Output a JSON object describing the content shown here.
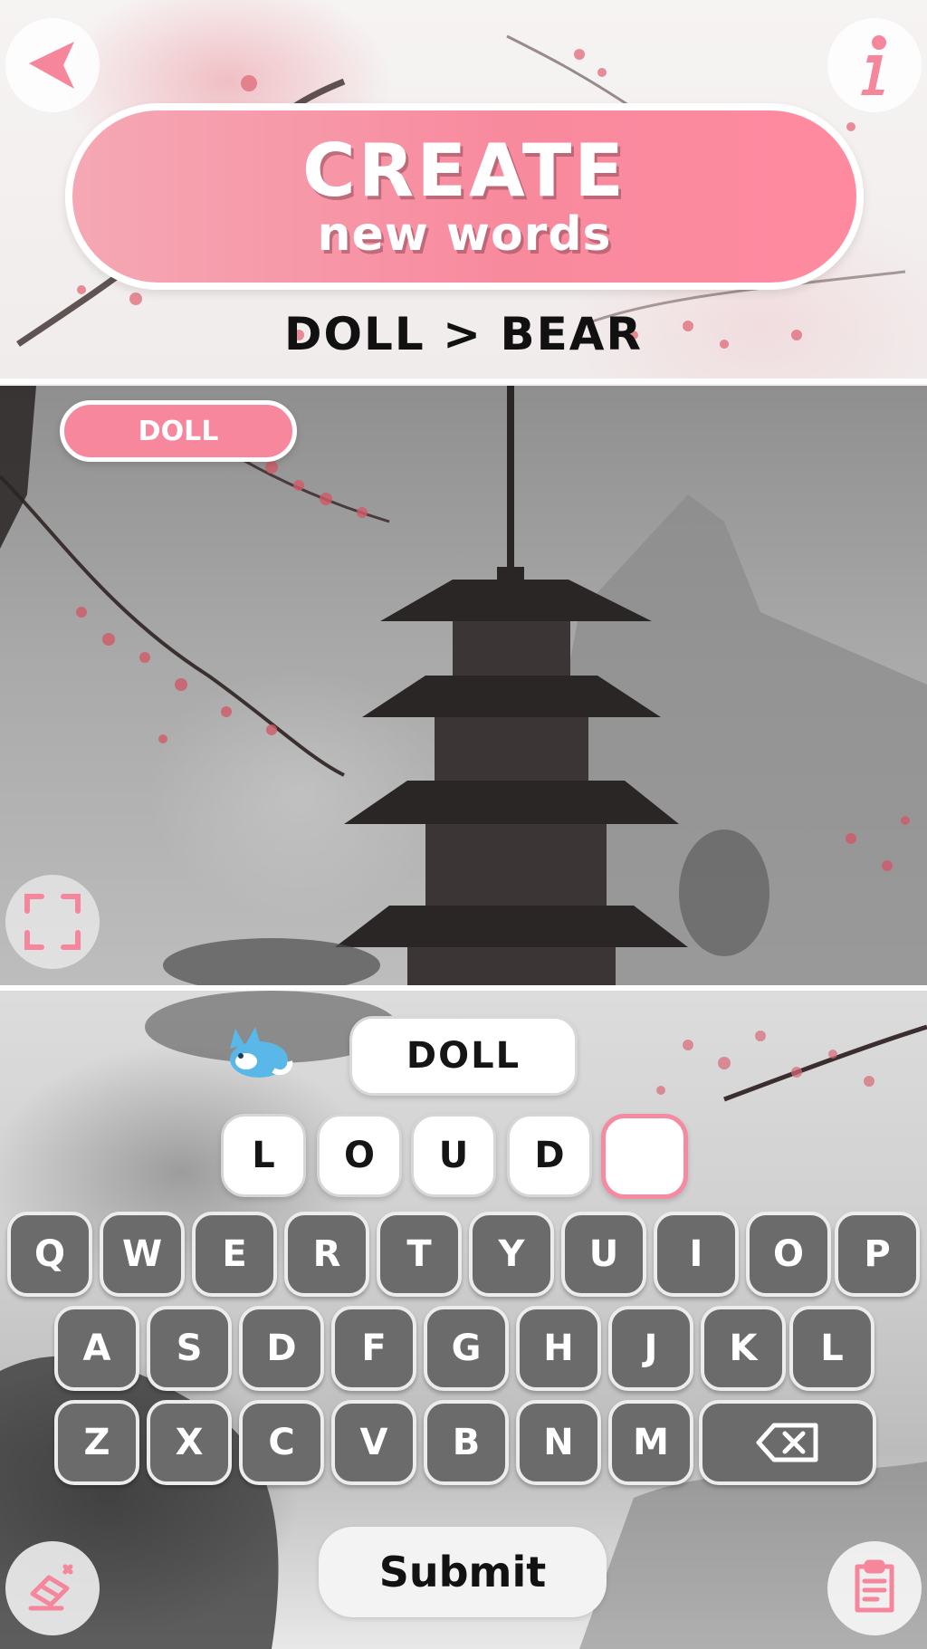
{
  "header": {
    "title_line1": "CREATE",
    "title_line2": "new words",
    "puzzle": "DOLL > BEAR"
  },
  "photo": {
    "word_tag": "DOLL"
  },
  "game": {
    "current_word": "DOLL",
    "tiles": [
      "L",
      "O",
      "U",
      "D",
      ""
    ]
  },
  "keyboard": {
    "row1": [
      "Q",
      "W",
      "E",
      "R",
      "T",
      "Y",
      "U",
      "I",
      "O",
      "P"
    ],
    "row2": [
      "A",
      "S",
      "D",
      "F",
      "G",
      "H",
      "J",
      "K",
      "L"
    ],
    "row3": [
      "Z",
      "X",
      "C",
      "V",
      "B",
      "N",
      "M"
    ]
  },
  "actions": {
    "submit": "Submit"
  },
  "colors": {
    "accent_pink": "#f7879c",
    "key_gray": "#6b6b6b"
  },
  "icons": {
    "back": "back-arrow-icon",
    "info": "info-icon",
    "expand": "expand-icon",
    "backspace": "backspace-icon",
    "eraser": "eraser-icon",
    "clipboard": "clipboard-icon"
  }
}
